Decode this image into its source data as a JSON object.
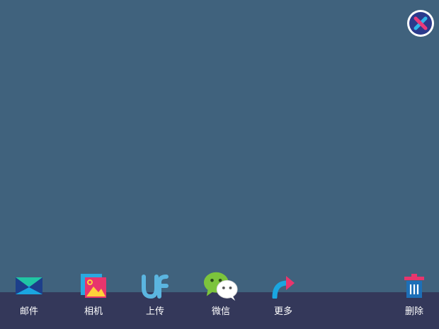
{
  "toolbar": {
    "items": [
      {
        "label": "邮件",
        "icon": "mail-icon"
      },
      {
        "label": "相机",
        "icon": "photo-icon"
      },
      {
        "label": "上传",
        "icon": "upload-icon"
      },
      {
        "label": "微信",
        "icon": "wechat-icon"
      },
      {
        "label": "更多",
        "icon": "share-arrow-icon"
      },
      {
        "label": "删除",
        "icon": "trash-icon"
      }
    ]
  },
  "colors": {
    "background": "#40627d",
    "toolbar": "#34385a",
    "close_ring": "#ffffff",
    "close_fill": "#2b3a8c",
    "close_x_pink": "#e83a7a",
    "close_x_blue": "#2fb5e8"
  }
}
